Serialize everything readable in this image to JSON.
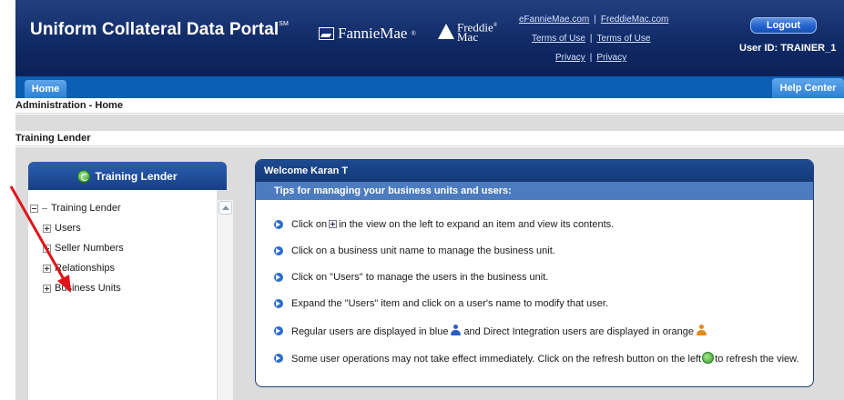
{
  "header": {
    "title": "Uniform Collateral Data Portal",
    "title_mark": "SM",
    "fannie_logo": "FannieMae",
    "fannie_reg": "®",
    "freddie_logo_line1": "Freddie",
    "freddie_logo_line2": "Mac",
    "freddie_reg": "®",
    "fannie_site": "eFannieMae.com",
    "freddie_site": "FreddieMac.com",
    "terms_fannie": "Terms of Use",
    "terms_freddie": "Terms of Use",
    "privacy_fannie": "Privacy",
    "privacy_freddie": "Privacy",
    "logout_label": "Logout",
    "user_id": "User ID: TRAINER_1"
  },
  "tabs": {
    "home": "Home",
    "help": "Help Center"
  },
  "breadcrumb": "Administration - Home",
  "lender_title": "Training Lender",
  "left_panel": {
    "header": "Training Lender",
    "tree": {
      "root": "Training Lender",
      "items": [
        {
          "label": "Users"
        },
        {
          "label": "Seller Numbers"
        },
        {
          "label": "Relationships"
        },
        {
          "label": "Business Units"
        }
      ]
    }
  },
  "welcome": {
    "title": "Welcome Karan T",
    "tips_title": "Tips for managing your business units and users:",
    "tip1_a": "Click on",
    "tip1_b": "in the view on the left to expand an item and view its contents.",
    "tip2": "Click on a business unit name to manage the business unit.",
    "tip3": "Click on \"Users\" to manage the users in the business unit.",
    "tip4": "Expand the \"Users\" item and click on a user's name to modify that user.",
    "tip5_a": "Regular users are displayed in blue",
    "tip5_b": "and Direct Integration users are displayed in orange",
    "tip6_a": "Some user operations may not take effect immediately. Click on the refresh button on the left",
    "tip6_b": "to refresh the view."
  },
  "colors": {
    "header_navy": "#102a66",
    "tab_blue": "#0d5fb5",
    "tips_bar": "#4c7cbf",
    "annotation_arrow": "#e0141b",
    "regular_user": "#2a5fc4",
    "integration_user": "#e08a1c"
  }
}
